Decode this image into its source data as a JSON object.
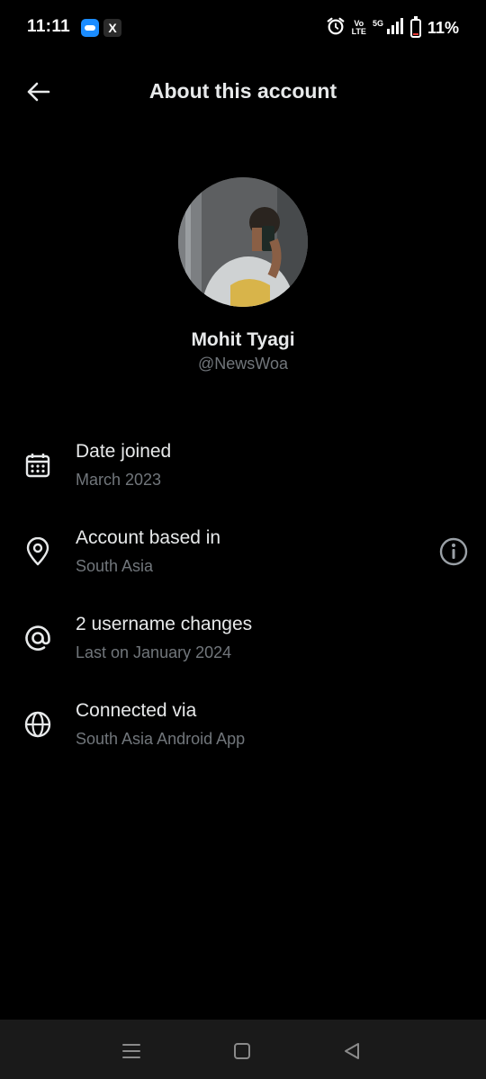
{
  "status_bar": {
    "time": "11:11",
    "notifications": [
      "paytm-icon",
      "x-icon"
    ],
    "x_glyph": "X",
    "volte_line1": "Vo",
    "volte_line2": "LTE",
    "network": "5G",
    "battery_percent": "11%",
    "battery_level": 0.11,
    "battery_color": "#e53935"
  },
  "header": {
    "title": "About this account",
    "back_icon": "arrow-left-icon"
  },
  "profile": {
    "name": "Mohit Tyagi",
    "handle": "@NewsWoa"
  },
  "rows": [
    {
      "icon": "calendar-icon",
      "title": "Date joined",
      "subtitle": "March 2023"
    },
    {
      "icon": "location-pin-icon",
      "title": "Account based in",
      "subtitle": "South Asia",
      "action_icon": "info-icon"
    },
    {
      "icon": "at-sign-icon",
      "title": "2 username changes",
      "subtitle": "Last on January 2024"
    },
    {
      "icon": "globe-icon",
      "title": "Connected via",
      "subtitle": "South Asia Android App"
    }
  ],
  "nav_bar": [
    "menu-icon",
    "home-square-icon",
    "back-triangle-icon"
  ],
  "colors": {
    "background": "#000000",
    "primary_text": "#e7e9ea",
    "secondary_text": "#71767b",
    "nav_bar": "#1a1a1a"
  }
}
